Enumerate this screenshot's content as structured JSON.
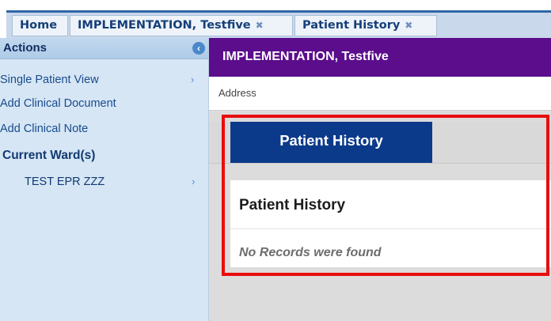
{
  "tabs": [
    {
      "label": "Home",
      "closable": false
    },
    {
      "label": "IMPLEMENTATION, Testfive",
      "closable": true
    },
    {
      "label": "Patient History",
      "closable": true
    }
  ],
  "sidebar": {
    "title": "Actions",
    "items": [
      {
        "label": "Single Patient View",
        "has_chevron": true
      },
      {
        "label": "Add Clinical Document"
      },
      {
        "label": "Add Clinical Note"
      }
    ],
    "section_title": "Current Ward(s)",
    "wards": [
      {
        "label": "TEST EPR ZZZ"
      }
    ]
  },
  "patient": {
    "name": "IMPLEMENTATION, Testfive",
    "address_label": "Address"
  },
  "content": {
    "tab_label": "Patient History",
    "panel_title": "Patient History",
    "empty_message": "No Records were found"
  },
  "colors": {
    "patient_bar": "#5b0d8c",
    "active_tab": "#0b3a8a",
    "highlight": "#e90d0d",
    "sidebar": "#d6e6f5"
  },
  "icons": {
    "close": "close-icon",
    "collapse": "collapse-left-icon",
    "chevron": "chevron-right-icon"
  }
}
